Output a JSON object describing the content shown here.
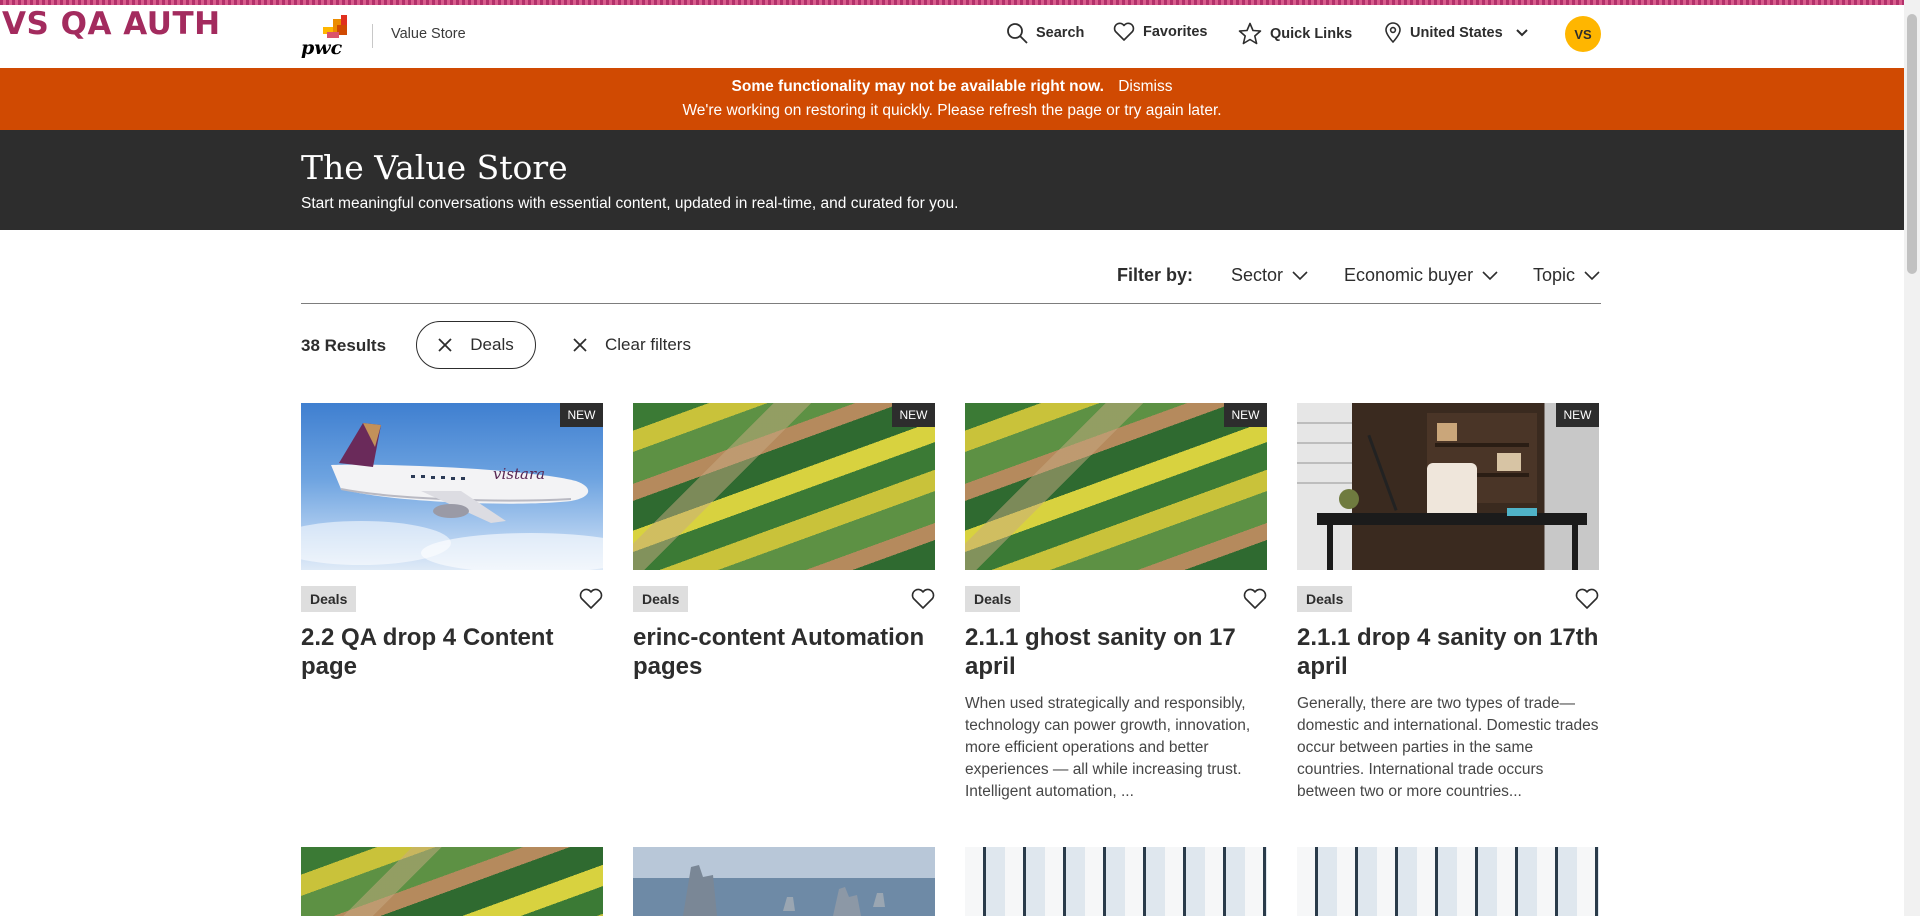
{
  "env_label": "VS QA AUTH",
  "header": {
    "logo_text": "pwc",
    "site_name": "Value Store",
    "nav": {
      "search": "Search",
      "favorites": "Favorites",
      "quick_links": "Quick Links",
      "region": "United States"
    },
    "avatar_initials": "VS"
  },
  "alert": {
    "title": "Some functionality may not be available right now.",
    "dismiss": "Dismiss",
    "message": "We're working on restoring it quickly. Please refresh the page or try again later."
  },
  "hero": {
    "title": "The Value Store",
    "subtitle": "Start meaningful conversations with essential content, updated in real-time, and curated for you."
  },
  "filters": {
    "label": "Filter by:",
    "sector": "Sector",
    "economic_buyer": "Economic buyer",
    "topic": "Topic",
    "results_count": "38 Results",
    "active_chip": "Deals",
    "clear": "Clear filters"
  },
  "cards": [
    {
      "badge": "NEW",
      "tag": "Deals",
      "title": "2.2 QA drop 4 Content page",
      "description": "",
      "image": "airplane"
    },
    {
      "badge": "NEW",
      "tag": "Deals",
      "title": "erinc-content Automation pages",
      "description": "",
      "image": "aerial-fields"
    },
    {
      "badge": "NEW",
      "tag": "Deals",
      "title": "2.1.1 ghost sanity on 17 april",
      "description": "When used strategically and responsibly, technology can power growth, innovation, more efficient operations and better experiences — all while increasing trust. Intelligent automation, ...",
      "image": "aerial-fields"
    },
    {
      "badge": "NEW",
      "tag": "Deals",
      "title": "2.1.1 drop 4 sanity on 17th april",
      "description": "Generally, there are two types of trade—domestic and international. Domestic trades occur between parties in the same countries. International trade occurs between two or more countries...",
      "image": "office-desk"
    }
  ],
  "colors": {
    "brand_orange": "#d04a02",
    "dark": "#2d2d2d",
    "avatar_yellow": "#ffb600",
    "env_label": "#a32b5e"
  }
}
